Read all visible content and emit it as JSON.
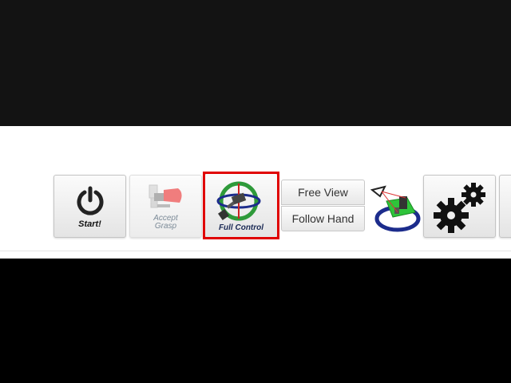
{
  "toolbar": {
    "start_label": "Start!",
    "accept_grasp_label_line1": "Accept",
    "accept_grasp_label_line2": "Grasp",
    "full_control_label": "Full Control",
    "free_view_label": "Free View",
    "follow_hand_label": "Follow Hand",
    "selected_mode": "Full Control"
  },
  "icons": {
    "start": "power-icon",
    "accept_grasp": "gripper-icon",
    "full_control": "gripper-ring-control-icon",
    "navigation": "navigation-cursor-icon",
    "settings": "gears-icon"
  },
  "colors": {
    "selection_highlight": "#e00000",
    "ring_green": "#2e9a3a",
    "ring_red": "#cc2222",
    "navigation_green": "#2ec43a",
    "navigation_blue": "#1c2c8c"
  }
}
